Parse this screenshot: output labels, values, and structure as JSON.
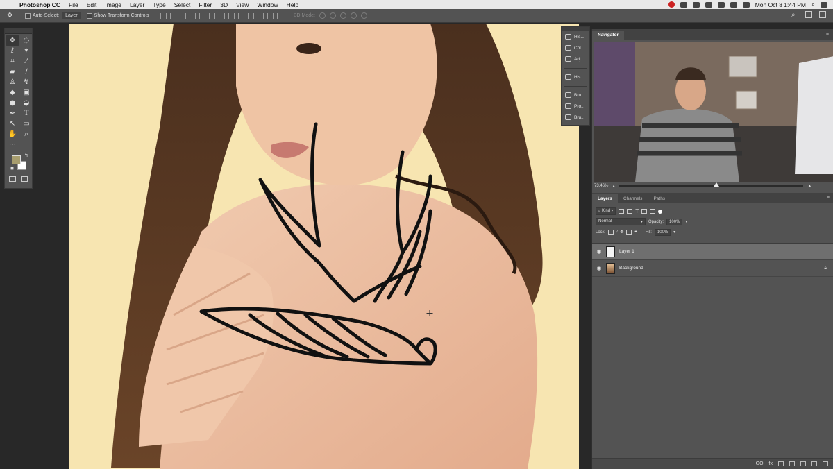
{
  "menubar": {
    "app_name": "Photoshop CC",
    "items": [
      "File",
      "Edit",
      "Image",
      "Layer",
      "Type",
      "Select",
      "Filter",
      "3D",
      "View",
      "Window",
      "Help"
    ],
    "clock": "Mon Oct 8  1:44 PM"
  },
  "options_bar": {
    "auto_select_label": "Auto-Select:",
    "auto_select_value": "Layer",
    "transform_label": "Show Transform Controls",
    "mode_3d_label": "3D Mode:"
  },
  "tools": {
    "foreground_color": "#a79d6e",
    "background_color": "#ffffff"
  },
  "icon_panel": {
    "items": [
      "His...",
      "Col...",
      "Adj...",
      "His...",
      "Bru...",
      "Pro...",
      "Bru..."
    ]
  },
  "navigator": {
    "tab_label": "Navigator",
    "zoom": "73.46%"
  },
  "layers_panel": {
    "tabs": [
      "Layers",
      "Channels",
      "Paths"
    ],
    "filter_kind": "Kind",
    "blend_mode": "Normal",
    "opacity_label": "Opacity:",
    "opacity_value": "100%",
    "lock_label": "Lock:",
    "fill_label": "Fill:",
    "fill_value": "100%",
    "layers": [
      {
        "name": "Layer 1",
        "selected": true
      },
      {
        "name": "Background",
        "selected": false
      }
    ],
    "footer_link_label": "GO",
    "footer_fx_label": "fx"
  }
}
